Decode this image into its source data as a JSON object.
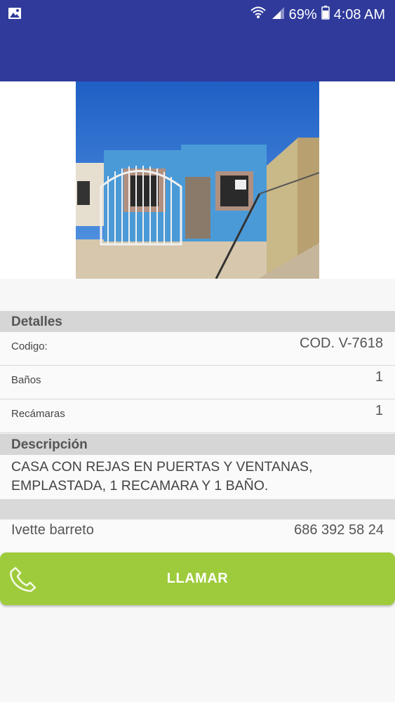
{
  "status_bar": {
    "battery": "69%",
    "time": "4:08 AM",
    "icons": [
      "image-icon",
      "wifi-icon",
      "signal-icon",
      "battery-icon"
    ]
  },
  "colors": {
    "app_bar": "#2f3a9b",
    "call_button": "#9ecb3b",
    "section_header": "#d6d6d6"
  },
  "details": {
    "heading": "Detalles",
    "rows": [
      {
        "label": "Codigo:",
        "value": "COD. V-7618"
      },
      {
        "label": "Baños",
        "value": "1"
      },
      {
        "label": "Recámaras",
        "value": "1"
      }
    ]
  },
  "description": {
    "heading": "Descripción",
    "text_line1": "CASA  CON REJAS EN PUERTAS Y VENTANAS,",
    "text_line2": "EMPLASTADA, 1 RECAMARA Y 1 BAÑO."
  },
  "contact": {
    "name": "Ivette barreto",
    "phone": "686 392 58 24"
  },
  "call_button": {
    "label": "LLAMAR",
    "icon": "phone-icon"
  }
}
